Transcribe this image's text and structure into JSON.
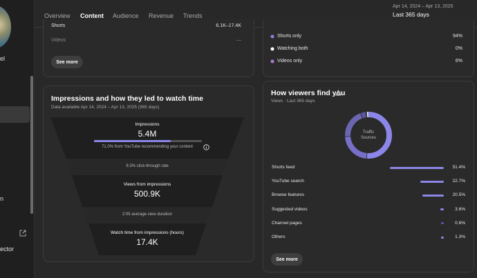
{
  "sidebar": {
    "label_el": "el",
    "label_n": "n",
    "label_ector": "ector"
  },
  "header": {
    "tabs": [
      {
        "label": "Overview",
        "active": false
      },
      {
        "label": "Content",
        "active": true
      },
      {
        "label": "Audience",
        "active": false
      },
      {
        "label": "Revenue",
        "active": false
      },
      {
        "label": "Trends",
        "active": false
      }
    ],
    "date_range": "Apr 14, 2024 – Apr 13, 2025",
    "date_label": "Last 365 days"
  },
  "top_left_card": {
    "rows": [
      {
        "label": "Shorts",
        "value": "6.1K–17.4K"
      },
      {
        "label": "Videos",
        "value": "—"
      }
    ],
    "see_more": "See more"
  },
  "top_right_card": {
    "rows": [
      {
        "label": "Shorts only",
        "value": "94%",
        "dot": "#8c86e8"
      },
      {
        "label": "Watching both",
        "value": "0%",
        "dot": "#ffffff"
      },
      {
        "label": "Videos only",
        "value": "6%",
        "dot": "#b07ad8"
      }
    ]
  },
  "impressions_card": {
    "title": "Impressions and how they led to watch time",
    "subtitle": "Data available Apr 14, 2024 – Apr 13, 2025 (365 days)",
    "impressions_label": "Impressions",
    "impressions_value": "5.4M",
    "impressions_note": "71.0% from YouTube recommending your content",
    "impressions_progress": 0.71,
    "ctr_note": "9.3% click-through rate",
    "views_label": "Views from impressions",
    "views_value": "500.9K",
    "avd_note": "2:05 average view duration",
    "watch_label": "Watch time from impressions (hours)",
    "watch_value": "17.4K"
  },
  "viewers_card": {
    "title": "How viewers find you",
    "subtitle": "Views · Last 365 days",
    "donut_line1": "Traffic",
    "donut_line2": "Sources",
    "sources": [
      {
        "label": "Shorts feed",
        "value": "51.4%",
        "pct": 51.4
      },
      {
        "label": "YouTube search",
        "value": "22.7%",
        "pct": 22.7
      },
      {
        "label": "Browse features",
        "value": "20.5%",
        "pct": 20.5
      },
      {
        "label": "Suggested videos",
        "value": "3.6%",
        "pct": 3.6
      },
      {
        "label": "Channel pages",
        "value": "0.6%",
        "pct": 0.6
      },
      {
        "label": "Others",
        "value": "1.3%",
        "pct": 1.3
      }
    ],
    "see_more": "See more"
  },
  "colors": {
    "accent": "#8c86e8",
    "background": "#282828",
    "card": "#2a2a2a"
  }
}
